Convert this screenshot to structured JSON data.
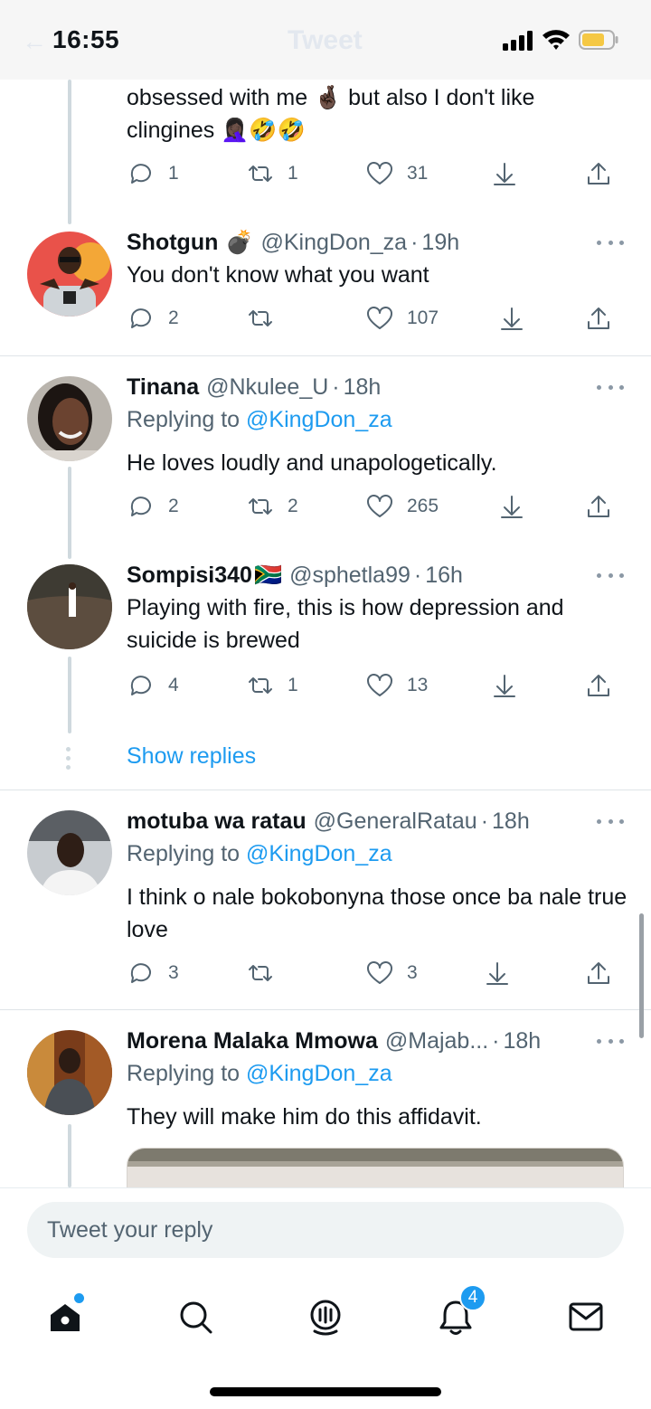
{
  "status_bar": {
    "time": "16:55",
    "ghost_title": "Tweet",
    "back_arrow": "←"
  },
  "colors": {
    "accent": "#1d9bf0",
    "text": "#0f1419",
    "secondary": "#536471",
    "battery": "#f5c844"
  },
  "feed": {
    "partial_tweet": {
      "text_line1": "obsessed with me",
      "emoji1": "🤞🏿",
      "text_line1b": "but also I don't like",
      "text_line2": "clingines",
      "emoji2": "🤦🏿‍♀️🤣🤣",
      "replies": "1",
      "retweets": "1",
      "likes": "31"
    },
    "tweets": [
      {
        "name": "Shotgun",
        "name_emoji": "💣",
        "handle": "@KingDon_za",
        "time": "19h",
        "text": "You don't know what you want",
        "replies": "2",
        "retweets": "",
        "likes": "107"
      },
      {
        "name": "Tinana",
        "handle": "@Nkulee_U",
        "time": "18h",
        "replying_prefix": "Replying to ",
        "replying_to": "@KingDon_za",
        "text": "He loves loudly and unapologetically.",
        "replies": "2",
        "retweets": "2",
        "likes": "265"
      },
      {
        "name": "Sompisi340",
        "name_emoji": "🇿🇦",
        "handle": "@sphetla99",
        "time": "16h",
        "text": "Playing with fire, this is how depression and suicide is brewed",
        "replies": "4",
        "retweets": "1",
        "likes": "13",
        "show_replies": "Show replies"
      },
      {
        "name": "motuba wa ratau",
        "handle": "@GeneralRatau",
        "time": "18h",
        "replying_prefix": "Replying to ",
        "replying_to": "@KingDon_za",
        "text": "I think o nale bokobonyna those once ba nale true love",
        "replies": "3",
        "retweets": "",
        "likes": "3"
      },
      {
        "name": "Morena Malaka Mmowa",
        "handle": "@Majab...",
        "time": "18h",
        "replying_prefix": "Replying to ",
        "replying_to": "@KingDon_za",
        "text": "They will make him do this affidavit."
      }
    ]
  },
  "reply_bar": {
    "placeholder": "Tweet your reply"
  },
  "tab_bar": {
    "tabs": [
      "home-icon",
      "search-icon",
      "spaces-icon",
      "notifications-icon",
      "messages-icon"
    ],
    "notifications_count": "4"
  }
}
